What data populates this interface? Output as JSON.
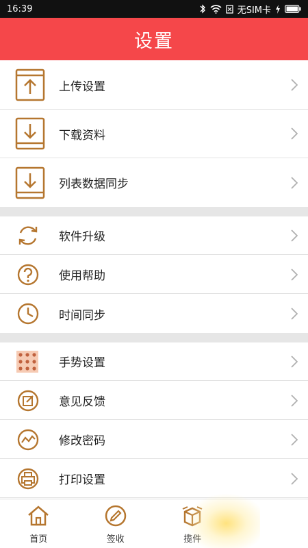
{
  "status_bar": {
    "time": "16:39",
    "carrier": "无SIM卡"
  },
  "header": {
    "title": "设置"
  },
  "sections": [
    {
      "items": [
        {
          "label": "上传设置",
          "icon": "upload-icon"
        },
        {
          "label": "下载资料",
          "icon": "download-icon"
        },
        {
          "label": "列表数据同步",
          "icon": "sync-list-icon"
        }
      ]
    },
    {
      "items": [
        {
          "label": "软件升级",
          "icon": "refresh-icon"
        },
        {
          "label": "使用帮助",
          "icon": "help-icon"
        },
        {
          "label": "时间同步",
          "icon": "clock-icon"
        }
      ]
    },
    {
      "items": [
        {
          "label": "手势设置",
          "icon": "gesture-grid-icon"
        },
        {
          "label": "意见反馈",
          "icon": "edit-feedback-icon"
        },
        {
          "label": "修改密码",
          "icon": "password-icon"
        },
        {
          "label": "打印设置",
          "icon": "printer-icon"
        }
      ]
    }
  ],
  "tabs": [
    {
      "label": "首页",
      "icon": "home-icon"
    },
    {
      "label": "签收",
      "icon": "sign-icon"
    },
    {
      "label": "揽件",
      "icon": "package-icon"
    },
    {
      "label": "",
      "icon": ""
    }
  ],
  "colors": {
    "header": "#f5474a",
    "icon": "#b5762f",
    "chevron": "#b0b0b0"
  }
}
